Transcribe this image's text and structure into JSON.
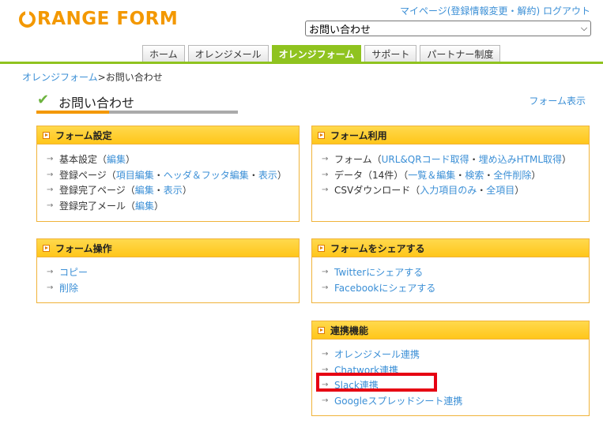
{
  "header": {
    "logo_text": "RANGE FORM",
    "top_links": {
      "mypage": "マイページ(登録情報変更・解約)",
      "logout": "ログアウト"
    },
    "form_select_value": "お問い合わせ"
  },
  "nav": {
    "tabs": [
      {
        "label": "ホーム"
      },
      {
        "label": "オレンジメール"
      },
      {
        "label": "オレンジフォーム"
      },
      {
        "label": "サポート"
      },
      {
        "label": "パートナー制度"
      }
    ]
  },
  "breadcrumb": {
    "link": "オレンジフォーム",
    "sep": ">",
    "current": "お問い合わせ"
  },
  "page": {
    "title": "お問い合わせ",
    "form_display_link": "フォーム表示"
  },
  "panels": {
    "settings": {
      "title": "フォーム設定",
      "items": [
        {
          "t1": "基本設定（",
          "l1": "編集",
          "t2": "）"
        },
        {
          "t1": "登録ページ（",
          "l1": "項目編集",
          "s1": "・",
          "l2": "ヘッダ＆フッタ編集",
          "s2": "・",
          "l3": "表示",
          "t2": "）"
        },
        {
          "t1": "登録完了ページ（",
          "l1": "編集",
          "s1": "・",
          "l2": "表示",
          "t2": "）"
        },
        {
          "t1": "登録完了メール（",
          "l1": "編集",
          "t2": "）"
        }
      ]
    },
    "usage": {
      "title": "フォーム利用",
      "items": [
        {
          "t1": "フォーム（",
          "l1": "URL&QRコード取得",
          "s1": "・",
          "l2": "埋め込みHTML取得",
          "t2": "）"
        },
        {
          "t1": "データ（14件）（",
          "l1": "一覧＆編集",
          "s1": "・",
          "l2": "検索",
          "s2": "・",
          "l3": "全件削除",
          "t2": "）"
        },
        {
          "t1": "CSVダウンロード（",
          "l1": "入力項目のみ",
          "s1": "・",
          "l2": "全項目",
          "t2": "）"
        }
      ]
    },
    "operations": {
      "title": "フォーム操作",
      "items": [
        {
          "label": "コピー"
        },
        {
          "label": "削除"
        }
      ]
    },
    "share": {
      "title": "フォームをシェアする",
      "items": [
        {
          "label": "Twitterにシェアする"
        },
        {
          "label": "Facebookにシェアする"
        }
      ]
    },
    "integrations": {
      "title": "連携機能",
      "items": [
        {
          "label": "オレンジメール連携"
        },
        {
          "label": "Chatwork連携"
        },
        {
          "label": "Slack連携"
        },
        {
          "label": "Googleスプレッドシート連携"
        }
      ]
    }
  },
  "colors": {
    "brand_orange": "#f39800",
    "nav_green": "#8fc31f",
    "link_blue": "#3b8fd6",
    "highlight_red": "#e60012"
  }
}
